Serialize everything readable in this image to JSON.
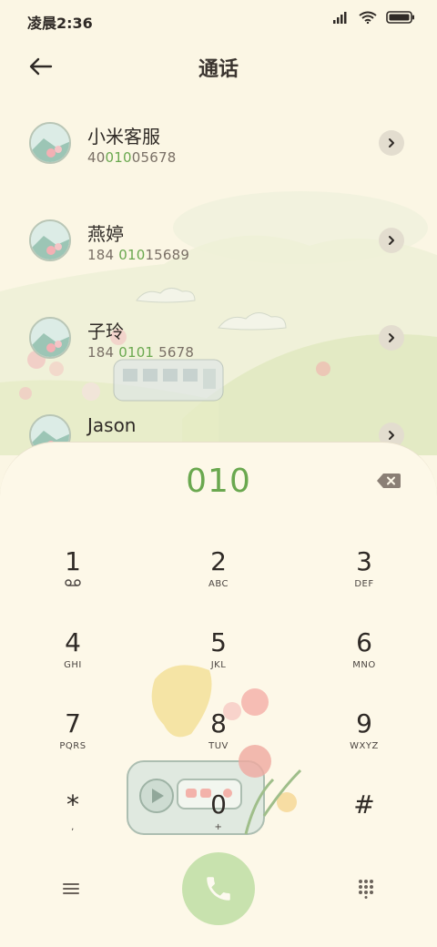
{
  "status_bar": {
    "time": "凌晨2:36"
  },
  "header": {
    "title": "通话",
    "back_icon": "back-arrow-icon"
  },
  "contacts": [
    {
      "name": "小米客服",
      "number_parts": [
        "40",
        "010",
        "05678"
      ]
    },
    {
      "name": "燕婷",
      "number_parts": [
        "184 ",
        "010",
        "15689"
      ]
    },
    {
      "name": "子玲",
      "number_parts": [
        "184 ",
        "0101",
        " 5678"
      ]
    },
    {
      "name": "Jason",
      "number_parts": [
        "",
        "",
        ""
      ]
    }
  ],
  "dialer": {
    "input": "010",
    "keys": [
      {
        "digit": "1",
        "letters": ""
      },
      {
        "digit": "2",
        "letters": "ABC"
      },
      {
        "digit": "3",
        "letters": "DEF"
      },
      {
        "digit": "4",
        "letters": "GHI"
      },
      {
        "digit": "5",
        "letters": "JKL"
      },
      {
        "digit": "6",
        "letters": "MNO"
      },
      {
        "digit": "7",
        "letters": "PQRS"
      },
      {
        "digit": "8",
        "letters": "TUV"
      },
      {
        "digit": "9",
        "letters": "WXYZ"
      },
      {
        "digit": "*",
        "letters": ","
      },
      {
        "digit": "0",
        "letters": "+"
      },
      {
        "digit": "#",
        "letters": ""
      }
    ]
  },
  "colors": {
    "background": "#fbf6e4",
    "highlight_green": "#6aa84f",
    "call_button": "#c8e2ae",
    "text": "#2f2a26"
  },
  "icons": {
    "voicemail": "voicemail-icon",
    "backspace": "backspace-icon",
    "call": "phone-icon",
    "menu": "menu-icon",
    "keypad": "dialpad-icon",
    "chevron": "chevron-right-icon"
  }
}
